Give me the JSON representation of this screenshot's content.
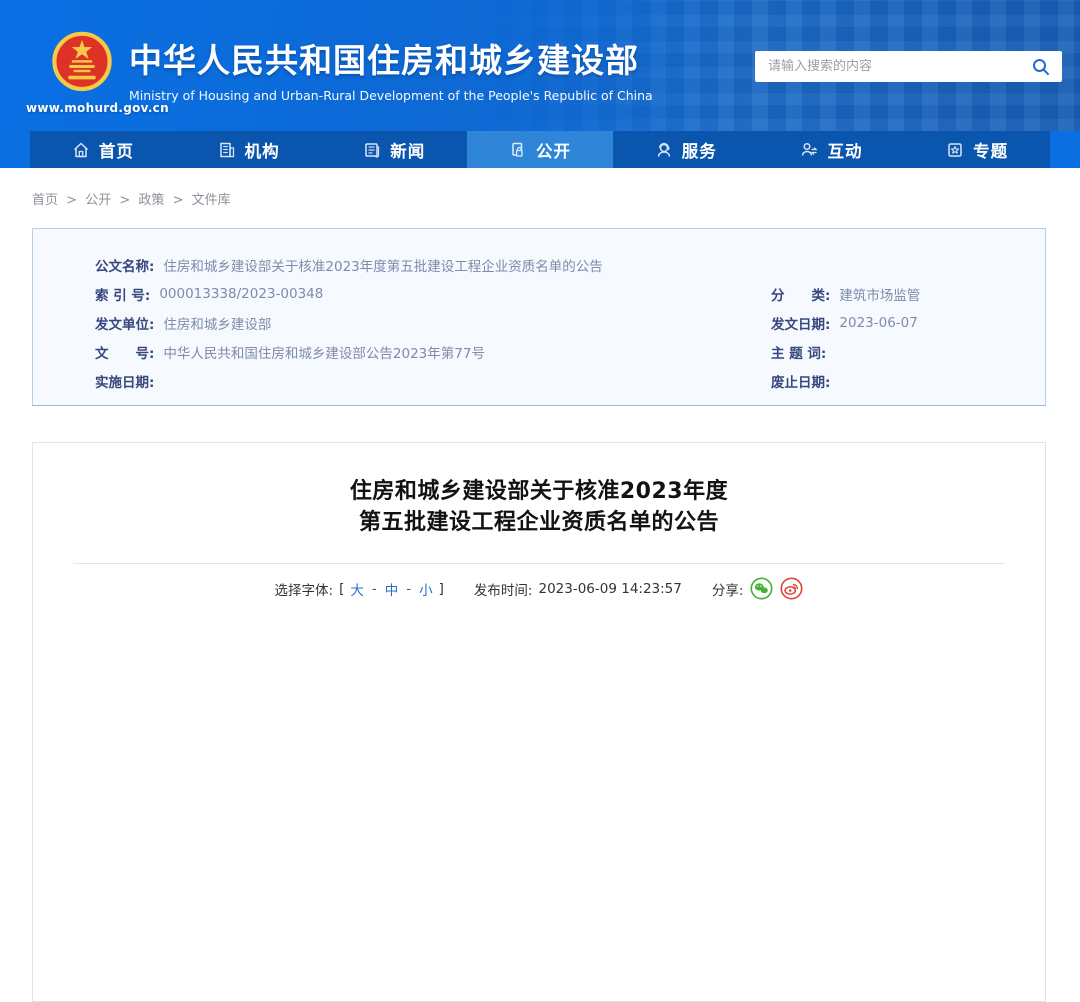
{
  "header": {
    "site_url": "www.mohurd.gov.cn",
    "title": "中华人民共和国住房和城乡建设部",
    "subtitle": "Ministry of Housing and Urban-Rural Development of the People's Republic of China",
    "search": {
      "placeholder": "请输入搜索的内容"
    }
  },
  "nav": {
    "items": [
      {
        "label": "首页",
        "icon": "home-icon",
        "active": false
      },
      {
        "label": "机构",
        "icon": "organization-icon",
        "active": false
      },
      {
        "label": "新闻",
        "icon": "news-icon",
        "active": false
      },
      {
        "label": "公开",
        "icon": "disclosure-icon",
        "active": true
      },
      {
        "label": "服务",
        "icon": "service-icon",
        "active": false
      },
      {
        "label": "互动",
        "icon": "interaction-icon",
        "active": false
      },
      {
        "label": "专题",
        "icon": "topic-icon",
        "active": false
      }
    ]
  },
  "breadcrumb": {
    "items": [
      "首页",
      "公开",
      "政策",
      "文件库"
    ],
    "separator": ">"
  },
  "meta_box": {
    "name_row": {
      "label": "公文名称:",
      "value": "住房和城乡建设部关于核准2023年度第五批建设工程企业资质名单的公告"
    },
    "left": [
      {
        "label": "索 引 号:",
        "value": "000013338/2023-00348"
      },
      {
        "label": "发文单位:",
        "value": "住房和城乡建设部"
      },
      {
        "label": "文　　号:",
        "value": "中华人民共和国住房和城乡建设部公告2023年第77号"
      },
      {
        "label": "实施日期:",
        "value": ""
      }
    ],
    "right": [
      {
        "label": "分　　类:",
        "value": "建筑市场监管"
      },
      {
        "label": "发文日期:",
        "value": "2023-06-07"
      },
      {
        "label": "主 题 词:",
        "value": ""
      },
      {
        "label": "废止日期:",
        "value": ""
      }
    ]
  },
  "article": {
    "title_line1": "住房和城乡建设部关于核准2023年度",
    "title_line2": "第五批建设工程企业资质名单的公告",
    "font_selector": {
      "label": "选择字体:",
      "bracket_open": "[",
      "options": [
        "大",
        "中",
        "小"
      ],
      "separator": "-",
      "bracket_close": "]"
    },
    "publish": {
      "label": "发布时间:",
      "value": "2023-06-09 14:23:57"
    },
    "share": {
      "label": "分享:"
    }
  },
  "colors": {
    "header_blue": "#0c69d6",
    "nav_blue": "#0a55ae",
    "nav_active_blue": "#2f85d8",
    "meta_label": "#36477e",
    "meta_value": "#7f8bab",
    "link_blue": "#2b6bc8",
    "wechat_green": "#45b035",
    "weibo_red": "#e0443a"
  }
}
